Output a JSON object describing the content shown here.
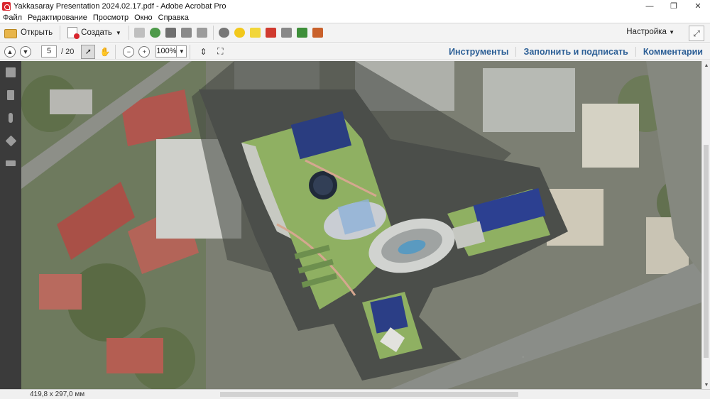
{
  "window": {
    "title": "Yakkasaray Presentation 2024.02.17.pdf - Adobe Acrobat Pro",
    "minimize": "—",
    "maximize": "❐",
    "close": "✕"
  },
  "menu": [
    "Файл",
    "Редактирование",
    "Просмотр",
    "Окно",
    "Справка"
  ],
  "toolbar": {
    "open_label": "Открыть",
    "create_label": "Создать",
    "settings_label": "Настройка"
  },
  "navigation": {
    "current_page": "5",
    "total_pages": "/ 20",
    "zoom": "100%"
  },
  "panels": {
    "tools": "Инструменты",
    "fill_sign": "Заполнить и подписать",
    "comments": "Комментарии"
  },
  "status": {
    "page_size": "419,8 x 297,0 мм"
  },
  "colors": {
    "link": "#2c5f96",
    "nav_panel": "#3b3b3b",
    "toolbar_bg": "#f3f3f3"
  }
}
